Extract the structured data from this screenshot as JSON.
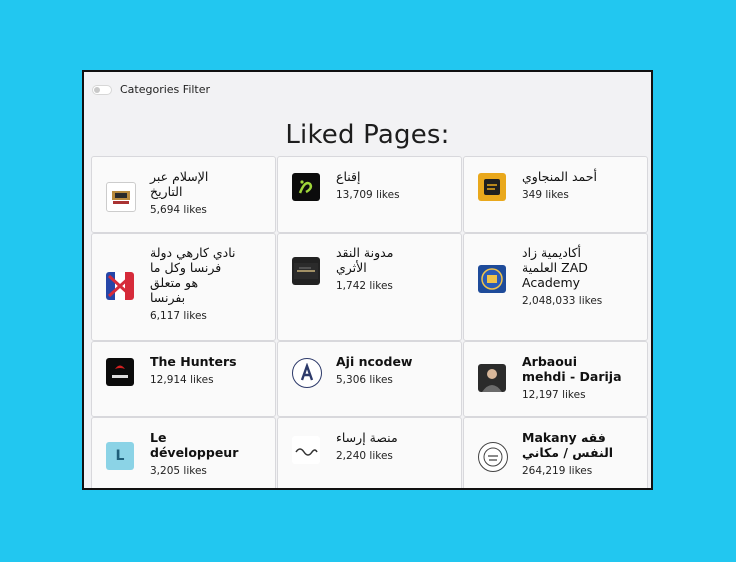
{
  "filter": {
    "label": "Categories Filter"
  },
  "title": "Liked Pages:",
  "pages": [
    {
      "name": "الإسلام عبر\nالتاريخ",
      "likes": "5,694 likes",
      "icon": "islam-history-logo-icon"
    },
    {
      "name": "إقناع",
      "likes": "13,709 likes",
      "icon": "iqnaa-logo-icon"
    },
    {
      "name": "أحمد المنجاوي",
      "likes": "349 likes",
      "icon": "ahmed-logo-icon"
    },
    {
      "name": "نادي كارهي دولة\nفرنسا وكل ما\nهو متعلق\nبفرنسا",
      "likes": "6,117 likes",
      "icon": "france-haters-logo-icon"
    },
    {
      "name": "مدونة النقد\nالأثري",
      "likes": "1,742 likes",
      "icon": "naqd-blog-logo-icon"
    },
    {
      "name": "أكاديمية زاد\nالعلمية ZAD\nAcademy",
      "likes": "2,048,033 likes",
      "icon": "zad-academy-logo-icon"
    },
    {
      "name": "The Hunters",
      "likes": "12,914 likes",
      "icon": "the-hunters-logo-icon"
    },
    {
      "name": "Aji ncodew",
      "likes": "5,306 likes",
      "icon": "aji-ncodew-logo-icon"
    },
    {
      "name": "Arbaoui\nmehdi - Darija",
      "likes": "12,197 likes",
      "icon": "arbaoui-avatar-icon"
    },
    {
      "name": "Le\ndéveloppeur",
      "likes": "3,205 likes",
      "icon": "le-developpeur-logo-icon"
    },
    {
      "name": "منصة إرساء",
      "likes": "2,240 likes",
      "icon": "irsaa-logo-icon"
    },
    {
      "name": "Makany فقه\nالنفس / مكاني",
      "likes": "264,219 likes",
      "icon": "makany-logo-icon"
    }
  ]
}
